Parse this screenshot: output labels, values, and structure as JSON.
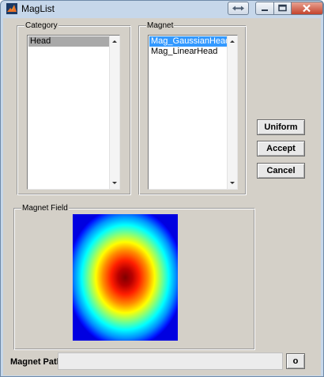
{
  "window": {
    "title": "MagList"
  },
  "category": {
    "panel_title": "Category",
    "items": [
      {
        "label": "Head",
        "selected": true
      }
    ]
  },
  "magnet": {
    "panel_title": "Magnet",
    "items": [
      {
        "label": "Mag_GaussianHead",
        "selected": true
      },
      {
        "label": "Mag_LinearHead",
        "selected": false
      }
    ]
  },
  "buttons": {
    "uniform": "Uniform",
    "accept": "Accept",
    "cancel": "Cancel",
    "open": "o"
  },
  "magnet_field": {
    "panel_title": "Magnet Field",
    "colormap": "jet",
    "field_shape": "gaussian"
  },
  "magnet_path": {
    "label": "Magnet Path",
    "value": ""
  },
  "colors": {
    "selected_focus": "#3399ff",
    "selected_inactive": "#a9a9a9",
    "client_background": "#d4d0c8",
    "window_frame": "#c6d7ea",
    "close_button": "#c4432d"
  }
}
